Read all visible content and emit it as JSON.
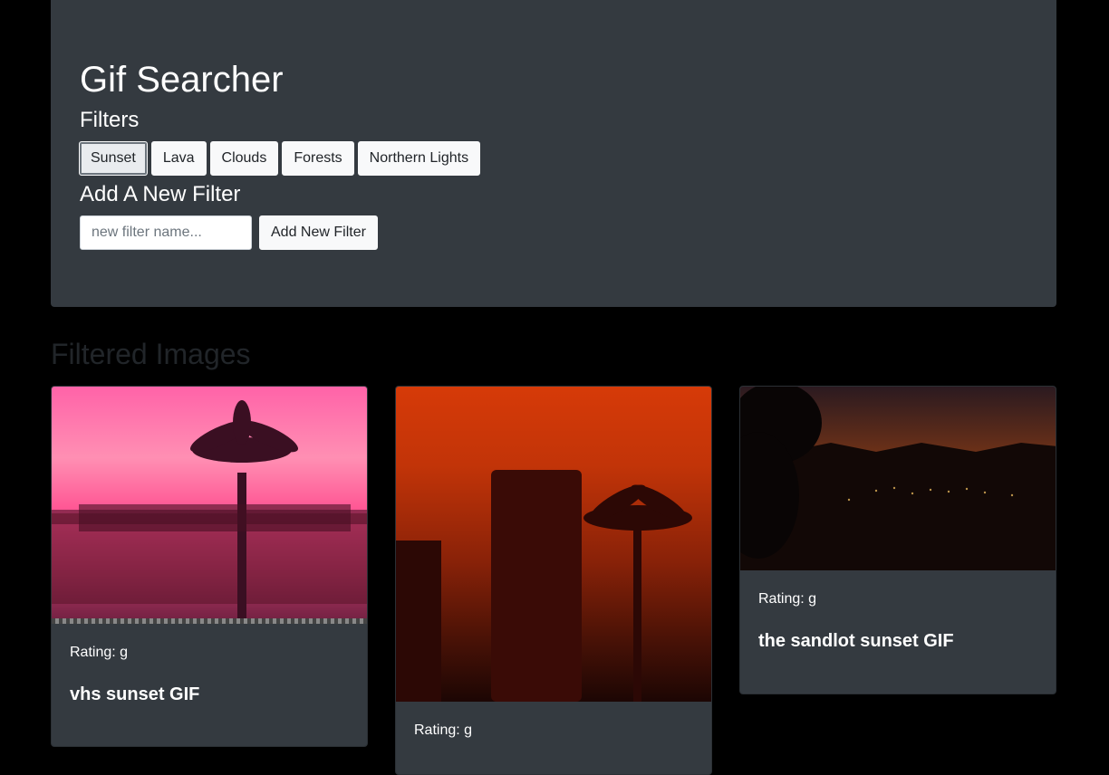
{
  "header": {
    "title": "Gif Searcher",
    "filters_heading": "Filters",
    "filters": [
      "Sunset",
      "Lava",
      "Clouds",
      "Forests",
      "Northern Lights"
    ],
    "active_filter": "Sunset",
    "add_heading": "Add A New Filter",
    "input_placeholder": "new filter name...",
    "input_value": "",
    "add_button_label": "Add New Filter"
  },
  "main": {
    "section_title": "Filtered Images",
    "cards": [
      {
        "rating": "Rating: g",
        "title": "vhs sunset GIF"
      },
      {
        "rating": "Rating: g",
        "title": ""
      },
      {
        "rating": "Rating: g",
        "title": "the sandlot sunset GIF"
      }
    ]
  },
  "colors": {
    "page_bg": "#000000",
    "panel_bg": "#343a40",
    "button_bg": "#f8f9fa",
    "section_title": "#212529"
  }
}
